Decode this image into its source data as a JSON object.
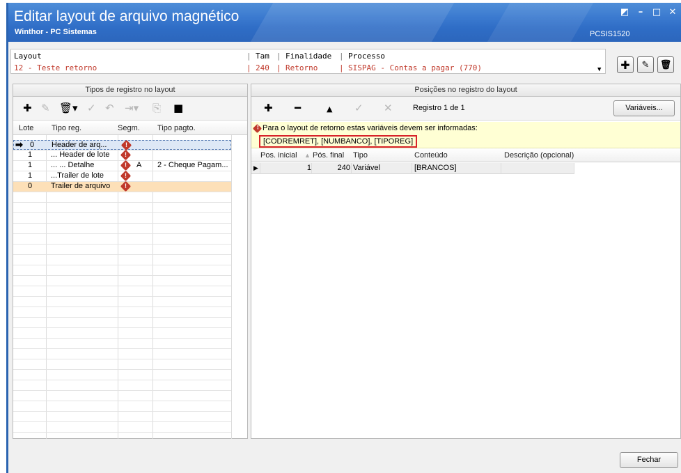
{
  "window": {
    "title": "Editar layout de arquivo magnético",
    "subtitle": "Winthor - PC Sistemas",
    "code": "PCSIS1520"
  },
  "layout": {
    "header_layout": "Layout",
    "header_tam": "Tam",
    "header_finalidade": "Finalidade",
    "header_processo": "Processo",
    "value_layout": "12 - Teste retorno",
    "value_tam": "240",
    "value_finalidade": "Retorno",
    "value_processo": "SISPAG - Contas a pagar (770)"
  },
  "left_panel": {
    "title": "Tipos de registro no layout",
    "columns": [
      "Lote",
      "Tipo reg.",
      "Segm.",
      "Tipo pagto."
    ],
    "rows": [
      {
        "lote": "0",
        "tipo": "Header de arq...",
        "segm": "",
        "pagto": ""
      },
      {
        "lote": "1",
        "tipo": "... Header de lote",
        "segm": "",
        "pagto": ""
      },
      {
        "lote": "1",
        "tipo": "... ... Detalhe",
        "segm": "A",
        "pagto": "2 - Cheque Pagam..."
      },
      {
        "lote": "1",
        "tipo": "...Trailer de lote",
        "segm": "",
        "pagto": ""
      },
      {
        "lote": "0",
        "tipo": "Trailer de arquivo",
        "segm": "",
        "pagto": ""
      }
    ]
  },
  "right_panel": {
    "title": "Posições no registro do layout",
    "registro": "Registro 1 de 1",
    "variaveis_label": "Variáveis...",
    "notice": "Para o layout de retorno estas variáveis devem ser informadas:",
    "notice_vars": "[CODREMRET], [NUMBANCO], [TIPOREG]",
    "columns": [
      "Pos. inicial",
      "Pós. final",
      "Tipo",
      "Conteúdo",
      "Descrição (opcional)"
    ],
    "rows": [
      {
        "pos_ini": "1",
        "pos_fim": "240",
        "tipo": "Variável",
        "conteudo": "[BRANCOS]",
        "descricao": ""
      }
    ]
  },
  "footer": {
    "fechar_label": "Fechar"
  },
  "colors": {
    "accent": "#2f6dc6",
    "selected_row": "#fde0b8",
    "warning": "#c0392b",
    "highlight_border": "#d8232a"
  }
}
